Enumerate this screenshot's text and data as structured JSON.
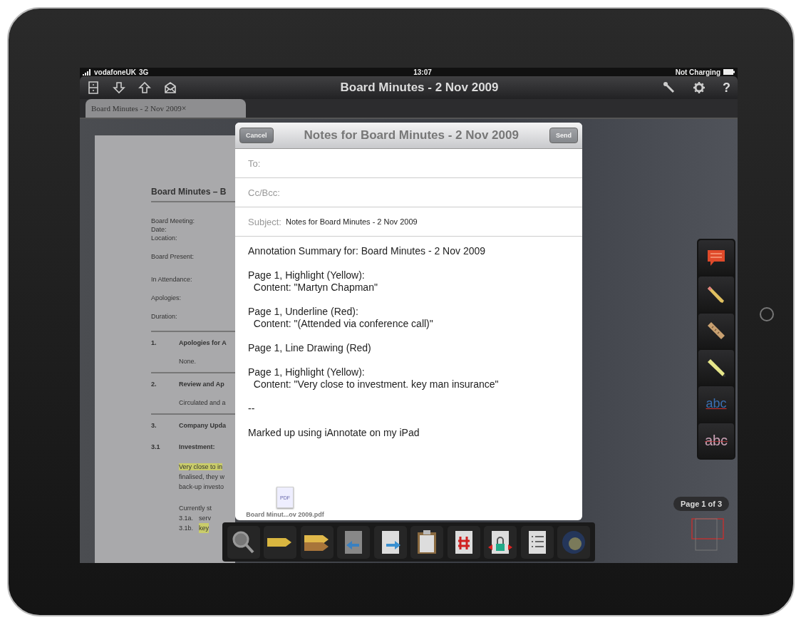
{
  "status_bar": {
    "carrier": "vodafoneUK",
    "network": "3G",
    "time": "13:07",
    "battery_text": "Not Charging"
  },
  "nav_bar": {
    "title": "Board Minutes - 2 Nov 2009",
    "help": "?"
  },
  "tabs": [
    {
      "label": "Board Minutes - 2 Nov 2009",
      "close": "×",
      "selected": true
    }
  ],
  "document": {
    "blocks": [
      {
        "kind": "heading",
        "text": "Board Minutes – B"
      },
      {
        "kind": "fields",
        "lines": [
          "Board Meeting:",
          "Date:",
          "Location:"
        ]
      },
      {
        "kind": "fields",
        "lines": [
          "Board Present:"
        ]
      },
      {
        "kind": "spaced_fields",
        "lines": [
          "In Attendance:"
        ]
      },
      {
        "kind": "fields",
        "lines": [
          "Apologies:"
        ]
      },
      {
        "kind": "fields",
        "lines": [
          "Duration:"
        ]
      },
      {
        "kind": "section",
        "number": "1.",
        "text": "Apologies for A",
        "rule": true
      },
      {
        "kind": "body",
        "lines": [
          "None."
        ]
      },
      {
        "kind": "section",
        "number": "2.",
        "text": "Review and Ap",
        "rule": true
      },
      {
        "kind": "body",
        "lines": [
          "Circulated and a"
        ]
      },
      {
        "kind": "section",
        "number": "3.",
        "text": "Company Upda",
        "rule": true
      },
      {
        "kind": "section",
        "number": "3.1",
        "text": "Investment:",
        "rule": false
      },
      {
        "kind": "paragraph",
        "lines": [
          {
            "text": "Very close to in",
            "highlighted": true
          },
          {
            "text": "finalised, they w",
            "highlighted": false
          },
          {
            "text": "back-up investo",
            "highlighted": false
          }
        ]
      },
      {
        "kind": "list",
        "intro": "Currently st",
        "items": [
          {
            "number": "3.1a.",
            "text": "serv",
            "highlighted": false
          },
          {
            "number": "3.1b.",
            "text": "key",
            "highlighted": true
          }
        ]
      }
    ]
  },
  "mail": {
    "title": "Notes for Board Minutes - 2 Nov 2009",
    "cancel": "Cancel",
    "send": {
      "label": "Send",
      "disabled": true
    },
    "fields": [
      {
        "label": "To:"
      },
      {
        "label": "Cc/Bcc:"
      },
      {
        "label": "Subject:",
        "value": "Notes for Board Minutes - 2 Nov 2009"
      }
    ],
    "body": [
      [
        "Annotation Summary for: Board Minutes - 2 Nov 2009"
      ],
      [
        "Page 1, Highlight (Yellow):",
        "  Content: \"Martyn Chapman\""
      ],
      [
        "Page 1, Underline (Red):",
        "  Content: \"(Attended via conference call)\""
      ],
      [
        "Page 1, Line Drawing (Red)"
      ],
      [
        "Page 1, Highlight (Yellow):",
        "  Content: \"Very close to investment. key man insurance\""
      ],
      [
        "--"
      ],
      [
        "Marked up using iAnnotate on my iPad"
      ]
    ],
    "attachment": {
      "type": "PDF",
      "filename": "Board Minut...ov 2009.pdf"
    }
  },
  "annotation_tools": [
    {
      "kind": "note"
    },
    {
      "kind": "pencil"
    },
    {
      "kind": "eraser"
    },
    {
      "kind": "highlighter"
    },
    {
      "kind": "underline",
      "label": "abc"
    },
    {
      "kind": "strikeout",
      "label": "abc"
    }
  ],
  "page_indicator": "Page 1 of 3"
}
